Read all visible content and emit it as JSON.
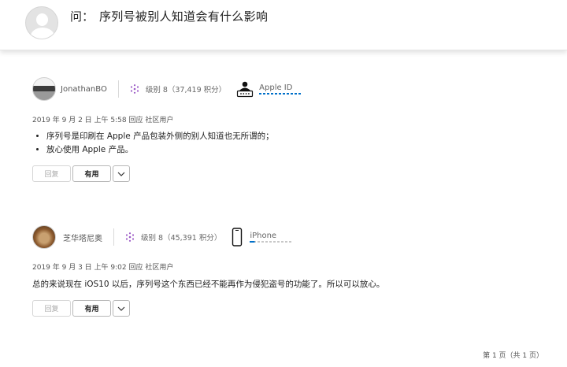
{
  "question": {
    "prefix": "问：",
    "title": "序列号被别人知道会有什么影响"
  },
  "answers": [
    {
      "user": "JonathanBO",
      "level": "级别 8（37,419 积分）",
      "badge": "Apple ID",
      "date": "2019 年 9 月 2 日 上午 5:58 回应 社区用户",
      "bullets": [
        "序列号是印刷在 Apple 产品包装外侧的别人知道也无所谓的；",
        "放心使用 Apple 产品。"
      ],
      "reply_label": "回复",
      "useful_label": "有用"
    },
    {
      "user": "芝华塔尼奥",
      "level": "级别 8（45,391 积分）",
      "badge": "iPhone",
      "date": "2019 年 9 月 3 日 上午 9:02 回应 社区用户",
      "text": "总的来说现在 iOS10 以后，序列号这个东西已经不能再作为侵犯盗号的功能了。所以可以放心。",
      "reply_label": "回复",
      "useful_label": "有用"
    }
  ],
  "pagination": "第 1 页（共 1 页）",
  "colors": {
    "accent": "#0070c9",
    "level_icon": "#9b59c6"
  }
}
